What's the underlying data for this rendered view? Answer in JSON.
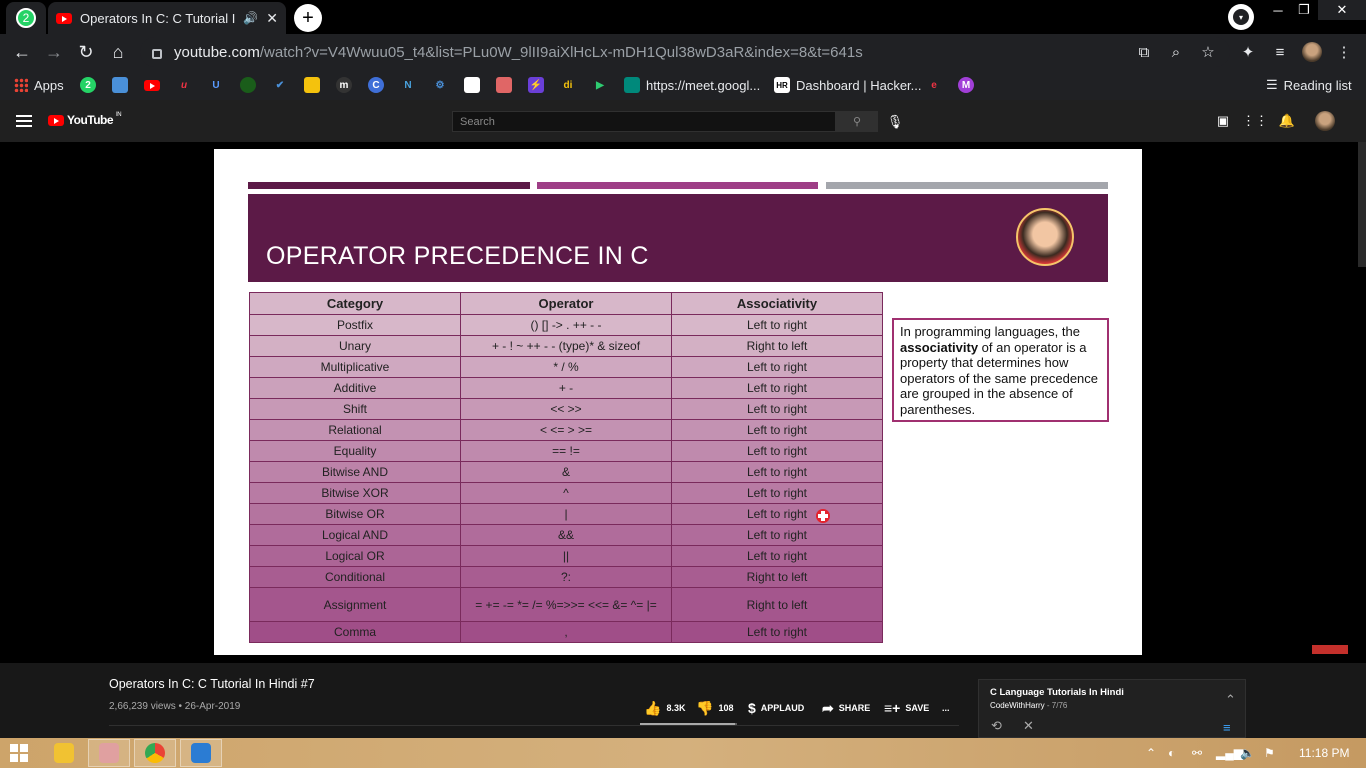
{
  "browser": {
    "whatsapp_badge": "2",
    "active_tab_title": "Operators In C: C Tutorial In Hindi #7",
    "url_host": "youtube.com",
    "url_path": "/watch?v=V4Wwuu05_t4&list=PLu0W_9lII9aiXlHcLx-mDH1Qul38wD3aR&index=8&t=641s",
    "profile_dd_badge": "▾"
  },
  "bookmarks": {
    "apps": "Apps",
    "whatsapp_badge": "2",
    "meet": "https://meet.googl...",
    "hackerrank": "Dashboard | Hacker...",
    "reading_list": "Reading list",
    "m_badge": "M"
  },
  "youtube": {
    "logo_text": "YouTube",
    "region": "IN",
    "search_placeholder": "Search"
  },
  "slide": {
    "title": "OPERATOR PRECEDENCE IN C",
    "headers": [
      "Category",
      "Operator",
      "Associativity"
    ],
    "rows": [
      [
        "Postfix",
        "() [] -> . ++ - -",
        "Left to right"
      ],
      [
        "Unary",
        "+ - ! ~ ++ - - (type)* & sizeof",
        "Right to left"
      ],
      [
        "Multiplicative",
        "* / %",
        "Left to right"
      ],
      [
        "Additive",
        "+ -",
        "Left to right"
      ],
      [
        "Shift",
        "<< >>",
        "Left to right"
      ],
      [
        "Relational",
        "< <= > >=",
        "Left to right"
      ],
      [
        "Equality",
        "== !=",
        "Left to right"
      ],
      [
        "Bitwise AND",
        "&",
        "Left to right"
      ],
      [
        "Bitwise XOR",
        "^",
        "Left to right"
      ],
      [
        "Bitwise OR",
        "|",
        "Left to right"
      ],
      [
        "Logical AND",
        "&&",
        "Left to right"
      ],
      [
        "Logical OR",
        "||",
        "Left to right"
      ],
      [
        "Conditional",
        "?:",
        "Right to left"
      ],
      [
        "Assignment",
        "= += -= *= /= %=>>= <<= &= ^= |=",
        "Right to left"
      ],
      [
        "Comma",
        ",",
        "Left to right"
      ]
    ],
    "note_prefix": "In programming languages, the ",
    "note_bold": "associativity",
    "note_suffix": " of an operator is a property that determines how operators of the same precedence are grouped in the absence of parentheses."
  },
  "video": {
    "title": "Operators In C: C Tutorial In Hindi #7",
    "meta": "2,66,239 views • 26-Apr-2019",
    "likes": "8.3K",
    "dislikes": "108",
    "applaud": "APPLAUD",
    "share": "SHARE",
    "save": "SAVE",
    "more": "...",
    "like_ratio": 0.98
  },
  "playlist": {
    "title": "C Language Tutorials In Hindi",
    "channel": "CodeWithHarry",
    "position": " - 7/76"
  },
  "taskbar": {
    "time": "11:18 PM"
  }
}
